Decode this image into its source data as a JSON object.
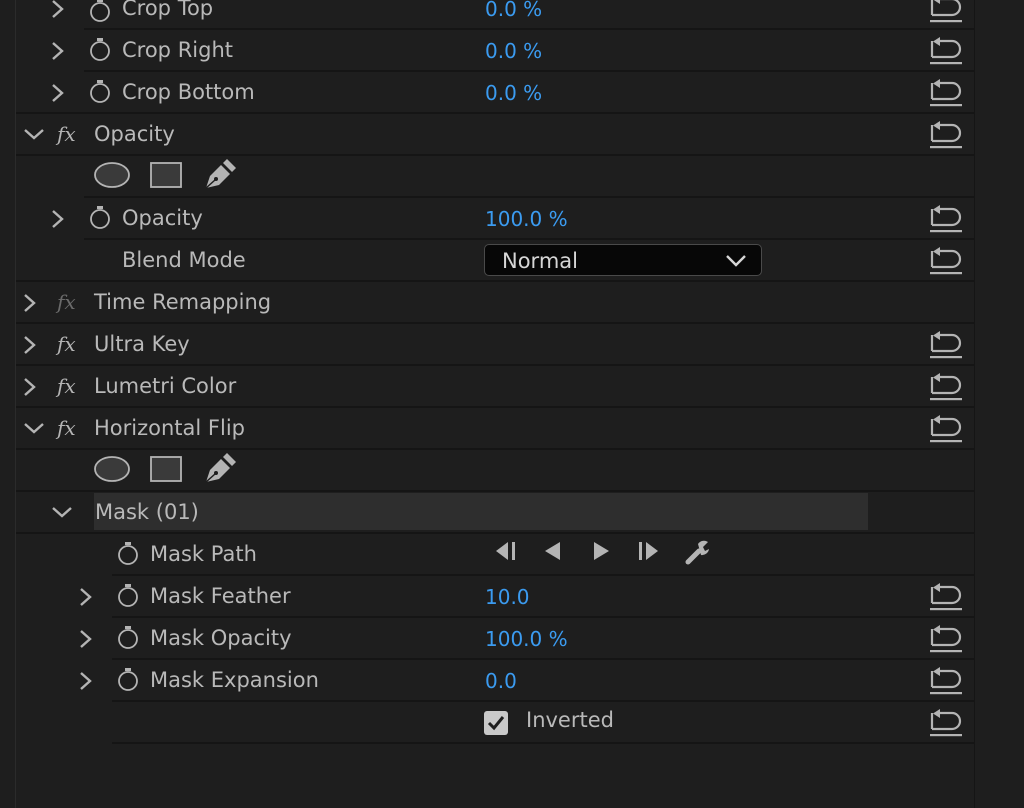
{
  "effect_controls": {
    "crop_top": {
      "label": "Crop Top",
      "value": "0.0 %"
    },
    "crop_right": {
      "label": "Crop Right",
      "value": "0.0 %"
    },
    "crop_bottom": {
      "label": "Crop Bottom",
      "value": "0.0 %"
    },
    "opacity_group": {
      "label": "Opacity"
    },
    "opacity_prop": {
      "label": "Opacity",
      "value": "100.0 %"
    },
    "blend_mode": {
      "label": "Blend Mode",
      "value": "Normal"
    },
    "time_remapping": {
      "label": "Time Remapping"
    },
    "ultra_key": {
      "label": "Ultra Key"
    },
    "lumetri_color": {
      "label": "Lumetri Color"
    },
    "horizontal_flip": {
      "label": "Horizontal Flip"
    },
    "mask": {
      "label": "Mask (01)"
    },
    "mask_path": {
      "label": "Mask Path"
    },
    "mask_feather": {
      "label": "Mask Feather",
      "value": "10.0"
    },
    "mask_opacity": {
      "label": "Mask Opacity",
      "value": "100.0 %"
    },
    "mask_expansion": {
      "label": "Mask Expansion",
      "value": "0.0"
    },
    "inverted": {
      "label": "Inverted",
      "checked": true
    }
  },
  "icons": {
    "expand": "chevron-right-icon",
    "collapse": "chevron-down-icon",
    "fx": "fx-icon",
    "stopwatch": "stopwatch-icon",
    "reset": "reset-parameter-icon",
    "ellipse_mask": "ellipse-mask-icon",
    "rect_mask": "rectangle-mask-icon",
    "pen_mask": "pen-mask-icon",
    "track_back_all": "track-selected-mask-backward-icon",
    "track_back_one": "track-selected-mask-backward-one-frame-icon",
    "track_fwd_one": "track-selected-mask-forward-one-frame-icon",
    "track_fwd_all": "track-selected-mask-forward-icon",
    "track_settings": "tracking-method-wrench-icon"
  },
  "colors": {
    "panel_bg": "#1e1e1e",
    "value_blue": "#3b9bf0",
    "label_text": "#b9b9b9",
    "icon_gray": "#b4b4b4",
    "separator": "#151515"
  }
}
